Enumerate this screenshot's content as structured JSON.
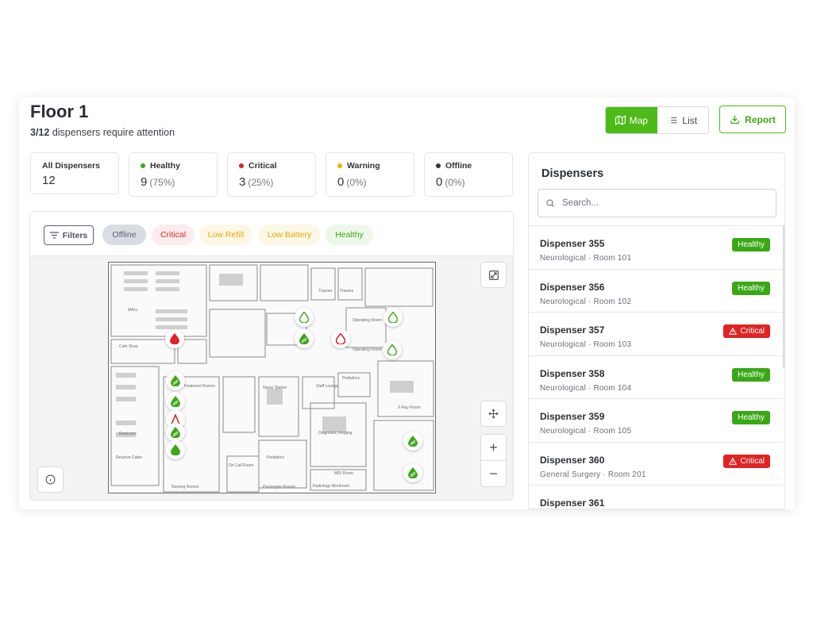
{
  "header": {
    "title": "Floor 1",
    "subtitle_count": "3/12",
    "subtitle_text": " dispensers require attention",
    "view_map": "Map",
    "view_list": "List",
    "report": "Report"
  },
  "stats": [
    {
      "label": "All Dispensers",
      "value": "12",
      "pct": ""
    },
    {
      "label": "Healthy",
      "value": "9",
      "pct": "(75%)",
      "color": "#3aa816"
    },
    {
      "label": "Critical",
      "value": "3",
      "pct": "(25%)",
      "color": "#e02424"
    },
    {
      "label": "Warning",
      "value": "0",
      "pct": "(0%)",
      "color": "#f0b000"
    },
    {
      "label": "Offline",
      "value": "0",
      "pct": "(0%)",
      "color": "#333333"
    }
  ],
  "filters": {
    "button": "Filters",
    "chips": [
      "Offline",
      "Critical",
      "Low Refill",
      "Low Battery",
      "Healthy"
    ]
  },
  "map": {
    "labels": {
      "mall": "MALL",
      "cafe": "Cafe Shop",
      "trauma1": "Trauma",
      "trauma2": "Trauma",
      "op1": "Operating Room",
      "op2": "Operating Room",
      "nurse": "Nurse Station",
      "staff": "Staff Lounge",
      "pediatrics": "Pediatrics",
      "diagnostic": "Diagnostic Imaging",
      "xray": "X-Ray Room",
      "restroom": "Restroom",
      "reserve": "Reserve Cabin",
      "nursing": "Nursing Rooms",
      "treatment": "Treatment Rooms",
      "mri": "MRI Room",
      "radiology": "Radiology Workroom",
      "oncall": "On Call Room",
      "passenger": "Passenger Rooms",
      "pediatrics2": "Pediatrics"
    }
  },
  "panel": {
    "title": "Dispensers",
    "search_placeholder": "Search...",
    "items": [
      {
        "name": "Dispenser 355",
        "sub": "Neurological · Room 101",
        "status": "Healthy"
      },
      {
        "name": "Dispenser 356",
        "sub": "Neurological · Room 102",
        "status": "Healthy"
      },
      {
        "name": "Dispenser 357",
        "sub": "Neurological · Room 103",
        "status": "Critical"
      },
      {
        "name": "Dispenser 358",
        "sub": "Neurological · Room 104",
        "status": "Healthy"
      },
      {
        "name": "Dispenser 359",
        "sub": "Neurological · Room 105",
        "status": "Healthy"
      },
      {
        "name": "Dispenser 360",
        "sub": "General Surgery · Room 201",
        "status": "Critical"
      },
      {
        "name": "Dispenser 361",
        "sub": "",
        "status": ""
      }
    ]
  },
  "colors": {
    "accent": "#4cbb17",
    "healthy": "#3aa816",
    "critical": "#e02424",
    "warning": "#f0b000",
    "offline": "#333333"
  }
}
